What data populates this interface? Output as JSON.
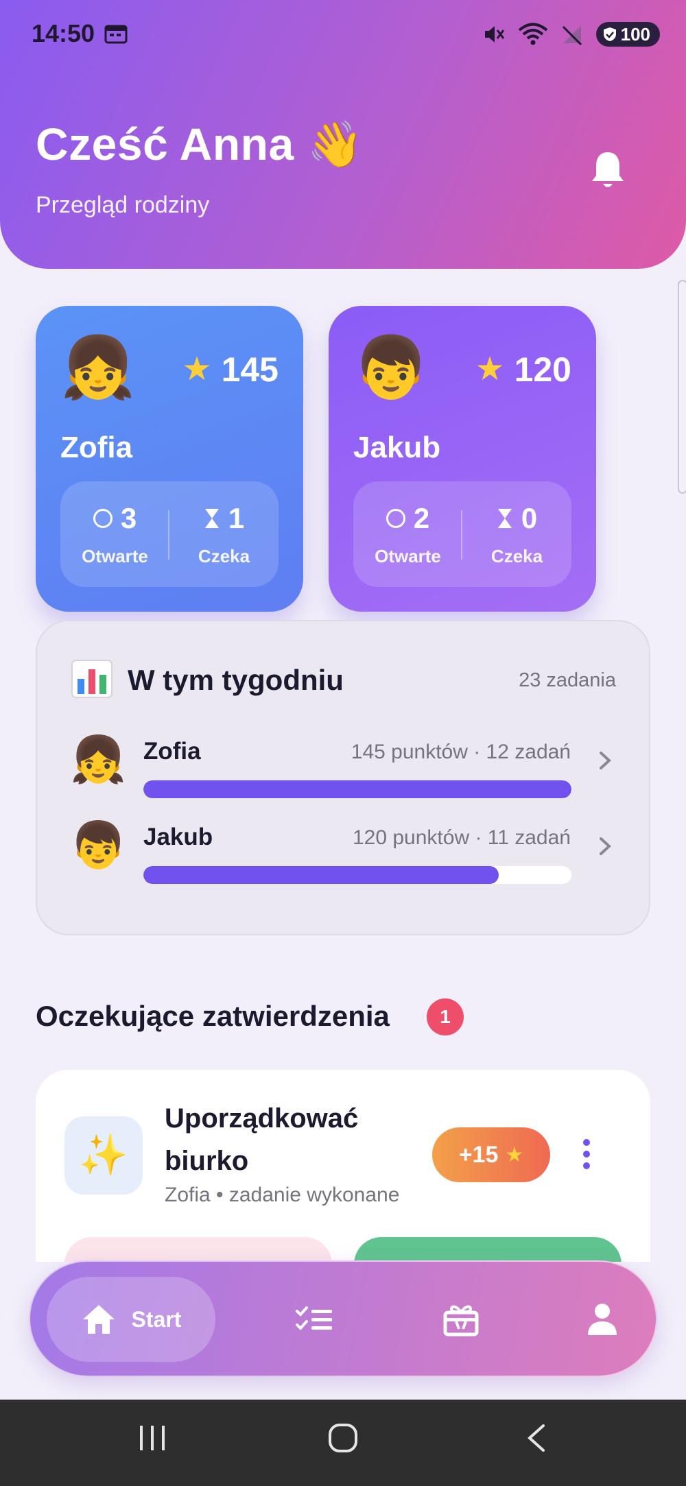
{
  "status_bar": {
    "time": "14:50",
    "battery": "100",
    "icons": [
      "calendar-icon",
      "mute-icon",
      "wifi-icon",
      "no-signal-icon",
      "battery-icon"
    ]
  },
  "header": {
    "greeting": "Cześć Anna 👋",
    "subtitle": "Przegląd rodziny"
  },
  "children": [
    {
      "avatar": "👧",
      "name": "Zofia",
      "points": "145",
      "open_count": "3",
      "open_label": "Otwarte",
      "waiting_count": "1",
      "waiting_label": "Czeka"
    },
    {
      "avatar": "👦",
      "name": "Jakub",
      "points": "120",
      "open_count": "2",
      "open_label": "Otwarte",
      "waiting_count": "0",
      "waiting_label": "Czeka"
    }
  ],
  "week": {
    "title": "W tym tygodniu",
    "count": "23 zadania",
    "rows": [
      {
        "avatar": "👧",
        "name": "Zofia",
        "meta": "145 punktów · 12 zadań",
        "progress": 1.0
      },
      {
        "avatar": "👦",
        "name": "Jakub",
        "meta": "120 punktów · 11 zadań",
        "progress": 0.83
      }
    ]
  },
  "pending": {
    "title": "Oczekujące zatwierdzenia",
    "badge": "1",
    "task": {
      "icon": "✨",
      "title": "Uporządkować biurko",
      "subtitle": "Zofia • zadanie wykonane",
      "reward": "+15",
      "reward_icon": "star-icon"
    }
  },
  "nav": {
    "active_label": "Start",
    "items": [
      "home-icon",
      "tasks-icon",
      "rewards-icon",
      "profile-icon"
    ]
  },
  "colors": {
    "accent": "#7152ef",
    "card_blue": "#5b93f6",
    "card_purple": "#8b5cf6",
    "badge_red": "#ef4e6a",
    "reward_orange": "#f3a04a"
  }
}
